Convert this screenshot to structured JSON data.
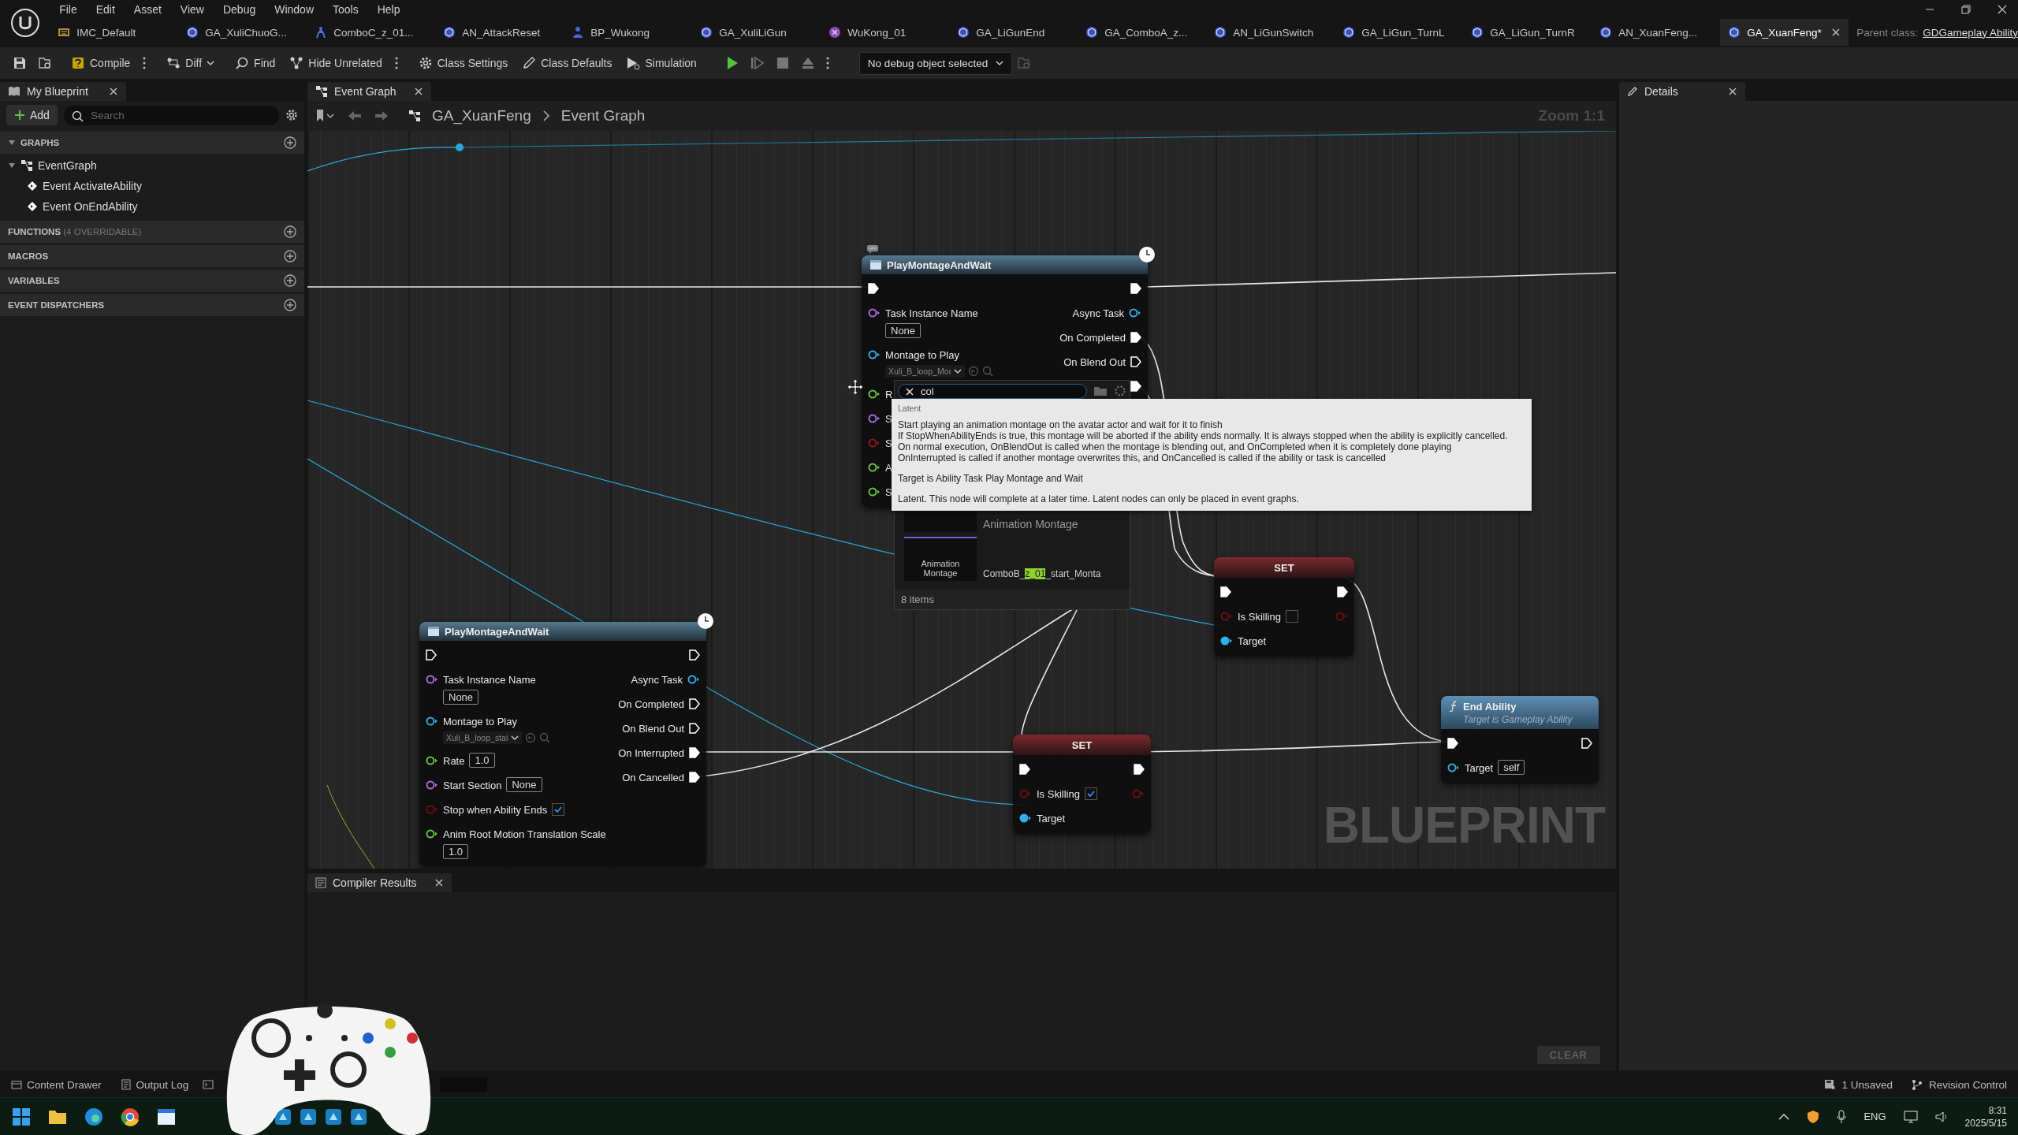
{
  "menu": [
    "File",
    "Edit",
    "Asset",
    "View",
    "Debug",
    "Window",
    "Tools",
    "Help"
  ],
  "document_tabs": [
    {
      "label": "IMC_Default",
      "kind": "input",
      "selected": false
    },
    {
      "label": "GA_XuliChuoG...",
      "kind": "ability",
      "selected": false
    },
    {
      "label": "ComboC_z_01...",
      "kind": "montage",
      "selected": false
    },
    {
      "label": "AN_AttackReset",
      "kind": "ability",
      "selected": false
    },
    {
      "label": "BP_Wukong",
      "kind": "character",
      "selected": false
    },
    {
      "label": "GA_XuliLiGun",
      "kind": "ability",
      "selected": false
    },
    {
      "label": "WuKong_01",
      "kind": "skeleton",
      "selected": false
    },
    {
      "label": "GA_LiGunEnd",
      "kind": "ability",
      "selected": false
    },
    {
      "label": "GA_ComboA_z...",
      "kind": "ability",
      "selected": false
    },
    {
      "label": "AN_LiGunSwitch",
      "kind": "ability",
      "selected": false
    },
    {
      "label": "GA_LiGun_TurnL",
      "kind": "ability",
      "selected": false
    },
    {
      "label": "GA_LiGun_TurnR",
      "kind": "ability",
      "selected": false
    },
    {
      "label": "AN_XuanFeng...",
      "kind": "ability",
      "selected": false
    },
    {
      "label": "GA_XuanFeng*",
      "kind": "ability",
      "selected": true
    }
  ],
  "parent_class": {
    "label": "Parent class:",
    "value": "GDGameplay Ability"
  },
  "toolbar": {
    "items": [
      {
        "kind": "save"
      },
      {
        "kind": "browse"
      },
      {
        "kind": "compile",
        "label": "Compile",
        "menu": true
      },
      {
        "kind": "diff",
        "label": "Diff",
        "menu": false
      },
      {
        "kind": "find",
        "label": "Find",
        "menu": false
      },
      {
        "kind": "hide",
        "label": "Hide Unrelated",
        "menu": true
      },
      {
        "kind": "settings",
        "label": "Class Settings",
        "menu": false
      },
      {
        "kind": "defaults",
        "label": "Class Defaults",
        "menu": false
      },
      {
        "kind": "simulation",
        "label": "Simulation",
        "menu": false
      },
      {
        "kind": "play"
      },
      {
        "kind": "step"
      },
      {
        "kind": "stop"
      },
      {
        "kind": "eject"
      },
      {
        "kind": "more"
      }
    ],
    "debug_object": "No debug object selected"
  },
  "my_blueprint": {
    "tab": "My Blueprint",
    "add": "Add",
    "search_placeholder": "Search",
    "sections": [
      {
        "title": "GRAPHS",
        "items": [
          {
            "label": "EventGraph",
            "expanded": true,
            "children": [
              {
                "label": "Event ActivateAbility"
              },
              {
                "label": "Event OnEndAbility"
              }
            ]
          }
        ]
      },
      {
        "title": "FUNCTIONS",
        "note": "(4 OVERRIDABLE)"
      },
      {
        "title": "MACROS"
      },
      {
        "title": "VARIABLES"
      },
      {
        "title": "EVENT DISPATCHERS"
      }
    ]
  },
  "graph": {
    "tab": "Event Graph",
    "breadcrumb": [
      "GA_XuanFeng",
      "Event Graph"
    ],
    "zoom": "Zoom 1:1",
    "watermark": "BLUEPRINT",
    "nodes": [
      {
        "kind": "latent",
        "title": "PlayMontageAndWait",
        "inputs": [
          {
            "kind": "exec",
            "connected": true
          },
          {
            "kind": "field",
            "label": "Task Instance Name",
            "color": "#a86ad8",
            "connected": false,
            "value": "None"
          },
          {
            "kind": "asset",
            "label": "Montage to Play",
            "color": "#35a8de",
            "connected": false,
            "value": "Xuli_B_loop_Moı"
          },
          {
            "kind": "data",
            "label": "R",
            "color": "#63c23c",
            "connected": false
          },
          {
            "kind": "data",
            "label": "S",
            "color": "#a86ad8",
            "connected": false
          },
          {
            "kind": "data",
            "label": "S",
            "color": "#8a1a1a",
            "connected": false
          },
          {
            "kind": "data",
            "label": "A",
            "color": "#63c23c",
            "connected": false
          },
          {
            "kind": "data",
            "label": "S",
            "color": "#63c23c",
            "connected": false
          }
        ],
        "outputs": [
          {
            "kind": "exec",
            "connected": true
          },
          {
            "kind": "data",
            "label": "Async Task",
            "color": "#35a8de",
            "connected": false
          },
          {
            "kind": "exec",
            "label": "On Completed",
            "connected": true
          },
          {
            "kind": "exec",
            "label": "On Blend Out",
            "connected": false
          },
          {
            "kind": "exec",
            "connected": true
          }
        ]
      },
      {
        "kind": "latent",
        "title": "PlayMontageAndWait",
        "inputs": [
          {
            "kind": "exec",
            "connected": false
          },
          {
            "kind": "field",
            "label": "Task Instance Name",
            "color": "#a86ad8",
            "connected": false,
            "value": "None"
          },
          {
            "kind": "asset",
            "label": "Montage to Play",
            "color": "#35a8de",
            "connected": false,
            "value": "Xuli_B_loop_stai"
          },
          {
            "kind": "inline_field",
            "label": "Rate",
            "color": "#63c23c",
            "connected": false,
            "value": "1.0"
          },
          {
            "kind": "inline_field",
            "label": "Start Section",
            "color": "#a86ad8",
            "connected": false,
            "value": "None"
          },
          {
            "kind": "check",
            "label": "Stop when Ability Ends",
            "color": "#6a1010",
            "connected": false,
            "checked": true
          },
          {
            "kind": "field",
            "label": "Anim Root Motion Translation Scale",
            "color": "#63c23c",
            "connected": false,
            "value": "1.0"
          }
        ],
        "outputs": [
          {
            "kind": "exec",
            "connected": false
          },
          {
            "kind": "data",
            "label": "Async Task",
            "color": "#35a8de",
            "connected": false
          },
          {
            "kind": "exec",
            "label": "On Completed",
            "connected": false
          },
          {
            "kind": "exec",
            "label": "On Blend Out",
            "connected": false
          },
          {
            "kind": "exec",
            "label": "On Interrupted",
            "connected": true
          },
          {
            "kind": "exec",
            "label": "On Cancelled",
            "connected": true
          }
        ]
      },
      {
        "kind": "set",
        "title": "SET",
        "inputs": [
          {
            "kind": "exec",
            "connected": true
          },
          {
            "kind": "check",
            "label": "Is Skilling",
            "color": "#6a1010",
            "connected": false,
            "checked": true
          },
          {
            "kind": "data",
            "label": "Target",
            "color": "#2fb0ea",
            "connected": true
          }
        ],
        "outputs": [
          {
            "kind": "exec",
            "connected": true
          },
          {
            "kind": "data",
            "color": "#6a1010",
            "connected": false
          }
        ]
      },
      {
        "kind": "set",
        "title": "SET",
        "inputs": [
          {
            "kind": "exec",
            "connected": true
          },
          {
            "kind": "check",
            "label": "Is Skilling",
            "color": "#6a1010",
            "connected": false,
            "checked": false
          },
          {
            "kind": "data",
            "label": "Target",
            "color": "#2fb0ea",
            "connected": true
          }
        ],
        "outputs": [
          {
            "kind": "exec",
            "connected": true
          },
          {
            "kind": "data",
            "color": "#6a1010",
            "connected": false
          }
        ]
      },
      {
        "kind": "function",
        "title": "End Ability",
        "subtitle": "Target is Gameplay Ability",
        "inputs": [
          {
            "kind": "exec",
            "connected": true
          },
          {
            "kind": "inline_field",
            "label": "Target",
            "color": "#35a8de",
            "connected": false,
            "value": "self"
          }
        ],
        "outputs": [
          {
            "kind": "exec",
            "connected": false
          }
        ]
      }
    ],
    "asset_picker": {
      "search": "col",
      "type_label": "Animation Montage",
      "thumb_label": "Animation Montage",
      "name_before": "ComboB_",
      "name_match": "z_01",
      "name_after": "_start_Monta",
      "count": "8 items"
    },
    "tooltip": {
      "category": "Latent",
      "description": "Start playing an animation montage on the avatar actor and wait for it to finish\nIf StopWhenAbilityEnds is true, this montage will be aborted if the ability ends normally. It is always stopped when the ability is explicitly cancelled.\nOn normal execution, OnBlendOut is called when the montage is blending out, and OnCompleted when it is completely done playing\nOnInterrupted is called if another montage overwrites this, and OnCancelled is called if the ability or task is cancelled",
      "target": "Target is Ability Task Play Montage and Wait",
      "latent": "Latent. This node will complete at a later time. Latent nodes can only be placed in event graphs."
    }
  },
  "compiler_results": {
    "tab": "Compiler Results",
    "clear": "CLEAR"
  },
  "details": {
    "tab": "Details"
  },
  "status_bar": {
    "left": [
      {
        "kind": "drawer",
        "label": "Content Drawer"
      },
      {
        "kind": "log",
        "label": "Output Log"
      }
    ],
    "right": [
      {
        "kind": "unsaved",
        "label": "1 Unsaved"
      },
      {
        "kind": "revision",
        "label": "Revision Control"
      }
    ]
  },
  "taskbar": {
    "apps": [
      {
        "kind": "windows"
      },
      {
        "kind": "folder"
      },
      {
        "kind": "edge"
      },
      {
        "kind": "chrome"
      },
      {
        "kind": "window"
      },
      {
        "kind": "app"
      },
      {
        "kind": "app"
      },
      {
        "kind": "app"
      },
      {
        "kind": "app"
      }
    ],
    "language": "ENG",
    "time": "8:31",
    "date": "2025/5/15"
  }
}
